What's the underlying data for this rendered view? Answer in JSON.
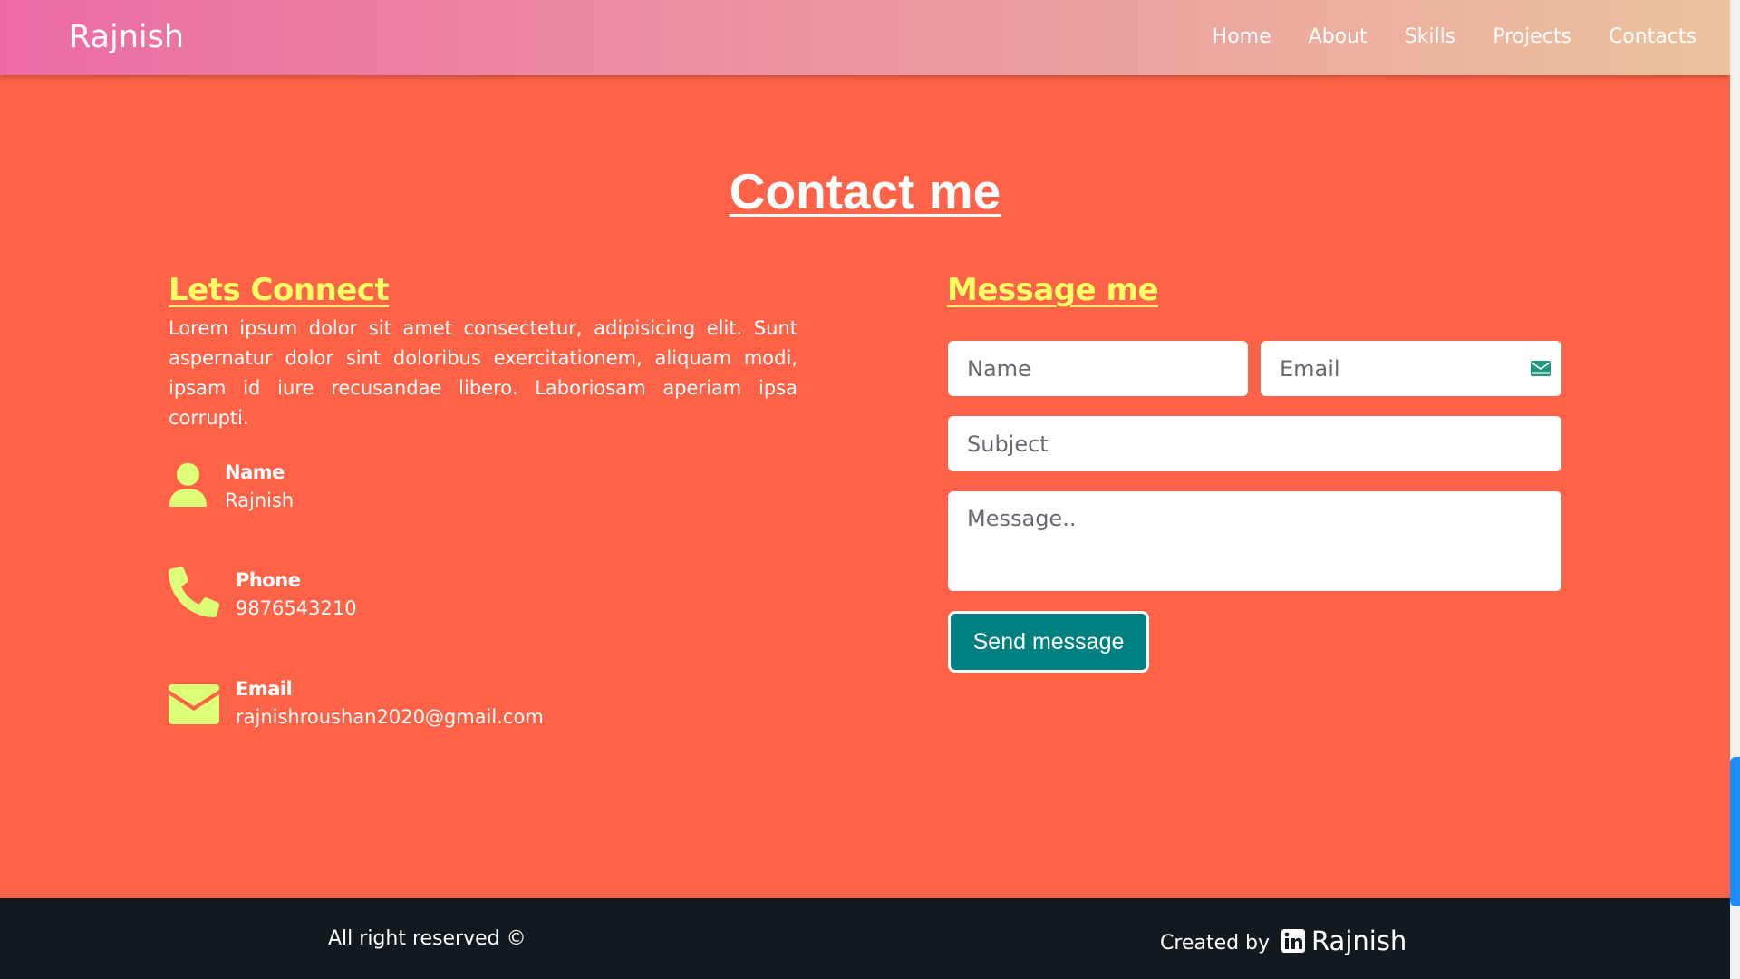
{
  "navbar": {
    "brand": "Rajnish",
    "links": [
      "Home",
      "About",
      "Skills",
      "Projects",
      "Contacts"
    ]
  },
  "contact": {
    "title": "Contact me",
    "left": {
      "heading": "Lets Connect",
      "text": "Lorem ipsum dolor sit amet consectetur, adipisicing elit. Sunt aspernatur dolor sint doloribus exercitationem, aliquam modi, ipsam id iure recusandae libero. Laboriosam aperiam ipsa corrupti.",
      "items": [
        {
          "icon": "user-icon",
          "label": "Name",
          "value": "Rajnish"
        },
        {
          "icon": "phone-icon",
          "label": "Phone",
          "value": "9876543210"
        },
        {
          "icon": "envelope-icon",
          "label": "Email",
          "value": "rajnishroushan2020@gmail.com"
        }
      ]
    },
    "form": {
      "heading": "Message me",
      "name_placeholder": "Name",
      "email_placeholder": "Email",
      "subject_placeholder": "Subject",
      "message_placeholder": "Message..",
      "send_label": "Send message"
    }
  },
  "footer": {
    "rights": "All right reserved ©",
    "credit_label": "Created by",
    "credit_icon": "linkedin-icon",
    "credit_name": "Rajnish"
  },
  "colors": {
    "background": "#ff6347",
    "accent_yellow": "#ffff66",
    "icon_green": "#ddff77",
    "button_teal": "#008080",
    "footer_bg": "#121a20"
  }
}
